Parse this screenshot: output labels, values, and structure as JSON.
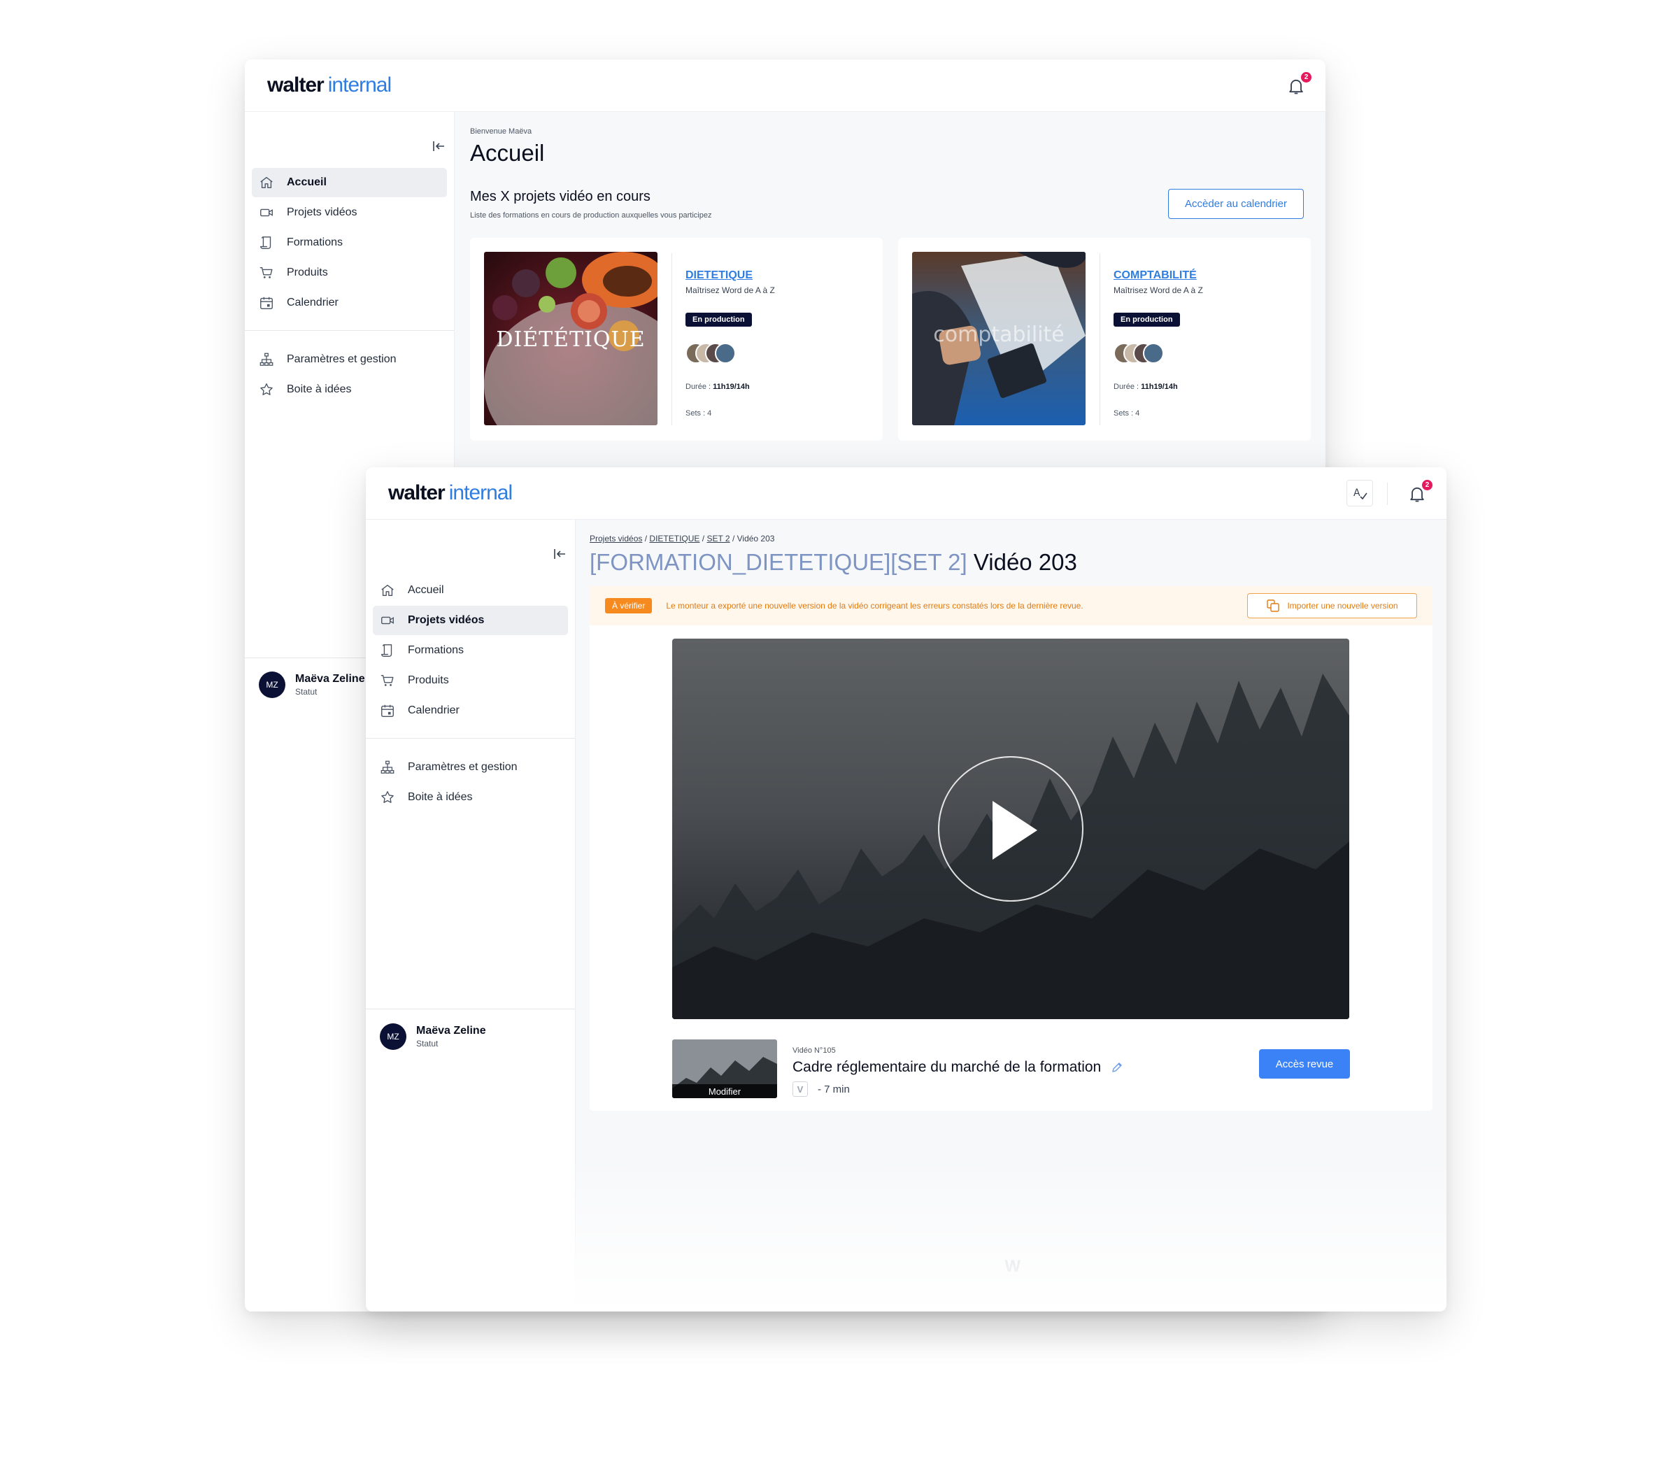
{
  "brand": {
    "name_part1": "walter",
    "name_part2": "internal",
    "accent_color": "#2f7de1",
    "navy": "#0b1035"
  },
  "notifications": {
    "count": "2"
  },
  "nav": {
    "items": [
      {
        "label": "Accueil",
        "icon": "home-icon"
      },
      {
        "label": "Projets vidéos",
        "icon": "video-camera-icon"
      },
      {
        "label": "Formations",
        "icon": "scroll-icon"
      },
      {
        "label": "Produits",
        "icon": "cart-icon"
      },
      {
        "label": "Calendrier",
        "icon": "calendar-icon"
      }
    ],
    "secondary": [
      {
        "label": "Paramètres et gestion",
        "icon": "hierarchy-icon"
      },
      {
        "label": "Boite à idées",
        "icon": "star-icon"
      }
    ]
  },
  "user": {
    "initials": "MZ",
    "name": "Maëva Zeline",
    "status": "Statut"
  },
  "home": {
    "welcome": "Bienvenue Maëva",
    "title": "Accueil",
    "section_title": "Mes X projets vidéo en cours",
    "section_subtitle": "Liste des formations en cours de production auxquelles vous participez",
    "calendar_button": "Accèder au calendrier",
    "cards": [
      {
        "title": "DIETETIQUE",
        "subtitle": "Maîtrisez Word de A à Z",
        "status": "En production",
        "thumb_text": "DIÉTÉTIQUE",
        "duration_label": "Durée :",
        "duration_value": "11h19/14h",
        "sets": "Sets : 4"
      },
      {
        "title": "COMPTABILITÉ",
        "subtitle": "Maîtrisez Word de A à Z",
        "status": "En production",
        "thumb_text": "comptabilité",
        "duration_label": "Durée :",
        "duration_value": "11h19/14h",
        "sets": "Sets : 4"
      }
    ]
  },
  "video_page": {
    "breadcrumb": {
      "root": "Projets vidéos",
      "formation": "DIETETIQUE",
      "set": "SET 2",
      "current": "Vidéo 203",
      "sep": "/"
    },
    "title_prefix": "[FORMATION_DIETETIQUE][SET 2]",
    "title_main": "Vidéo 203",
    "alert": {
      "tag": "À vérifier",
      "message": "Le monteur a exporté une nouvelle version de la vidéo corrigeant les erreurs constatés lors de la dernière revue.",
      "button": "Importer une nouvelle version"
    },
    "video": {
      "number": "Vidéo N°105",
      "title": "Cadre réglementaire du marché de la formation",
      "platform_glyph": "V",
      "duration": "- 7 min",
      "thumb_label": "Modifier",
      "review_button": "Accès revue"
    },
    "spellcheck_glyph": "A",
    "footer_mark": "W"
  }
}
